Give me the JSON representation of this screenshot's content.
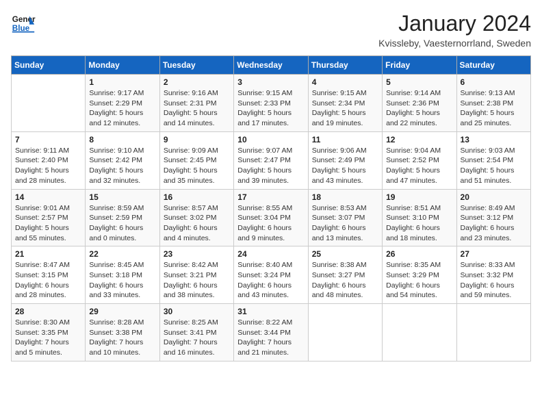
{
  "header": {
    "logo_general": "General",
    "logo_blue": "Blue",
    "title": "January 2024",
    "subtitle": "Kvissleby, Vaesternorrland, Sweden"
  },
  "calendar": {
    "days_of_week": [
      "Sunday",
      "Monday",
      "Tuesday",
      "Wednesday",
      "Thursday",
      "Friday",
      "Saturday"
    ],
    "weeks": [
      [
        {
          "day": "",
          "info": ""
        },
        {
          "day": "1",
          "info": "Sunrise: 9:17 AM\nSunset: 2:29 PM\nDaylight: 5 hours\nand 12 minutes."
        },
        {
          "day": "2",
          "info": "Sunrise: 9:16 AM\nSunset: 2:31 PM\nDaylight: 5 hours\nand 14 minutes."
        },
        {
          "day": "3",
          "info": "Sunrise: 9:15 AM\nSunset: 2:33 PM\nDaylight: 5 hours\nand 17 minutes."
        },
        {
          "day": "4",
          "info": "Sunrise: 9:15 AM\nSunset: 2:34 PM\nDaylight: 5 hours\nand 19 minutes."
        },
        {
          "day": "5",
          "info": "Sunrise: 9:14 AM\nSunset: 2:36 PM\nDaylight: 5 hours\nand 22 minutes."
        },
        {
          "day": "6",
          "info": "Sunrise: 9:13 AM\nSunset: 2:38 PM\nDaylight: 5 hours\nand 25 minutes."
        }
      ],
      [
        {
          "day": "7",
          "info": "Sunrise: 9:11 AM\nSunset: 2:40 PM\nDaylight: 5 hours\nand 28 minutes."
        },
        {
          "day": "8",
          "info": "Sunrise: 9:10 AM\nSunset: 2:42 PM\nDaylight: 5 hours\nand 32 minutes."
        },
        {
          "day": "9",
          "info": "Sunrise: 9:09 AM\nSunset: 2:45 PM\nDaylight: 5 hours\nand 35 minutes."
        },
        {
          "day": "10",
          "info": "Sunrise: 9:07 AM\nSunset: 2:47 PM\nDaylight: 5 hours\nand 39 minutes."
        },
        {
          "day": "11",
          "info": "Sunrise: 9:06 AM\nSunset: 2:49 PM\nDaylight: 5 hours\nand 43 minutes."
        },
        {
          "day": "12",
          "info": "Sunrise: 9:04 AM\nSunset: 2:52 PM\nDaylight: 5 hours\nand 47 minutes."
        },
        {
          "day": "13",
          "info": "Sunrise: 9:03 AM\nSunset: 2:54 PM\nDaylight: 5 hours\nand 51 minutes."
        }
      ],
      [
        {
          "day": "14",
          "info": "Sunrise: 9:01 AM\nSunset: 2:57 PM\nDaylight: 5 hours\nand 55 minutes."
        },
        {
          "day": "15",
          "info": "Sunrise: 8:59 AM\nSunset: 2:59 PM\nDaylight: 6 hours\nand 0 minutes."
        },
        {
          "day": "16",
          "info": "Sunrise: 8:57 AM\nSunset: 3:02 PM\nDaylight: 6 hours\nand 4 minutes."
        },
        {
          "day": "17",
          "info": "Sunrise: 8:55 AM\nSunset: 3:04 PM\nDaylight: 6 hours\nand 9 minutes."
        },
        {
          "day": "18",
          "info": "Sunrise: 8:53 AM\nSunset: 3:07 PM\nDaylight: 6 hours\nand 13 minutes."
        },
        {
          "day": "19",
          "info": "Sunrise: 8:51 AM\nSunset: 3:10 PM\nDaylight: 6 hours\nand 18 minutes."
        },
        {
          "day": "20",
          "info": "Sunrise: 8:49 AM\nSunset: 3:12 PM\nDaylight: 6 hours\nand 23 minutes."
        }
      ],
      [
        {
          "day": "21",
          "info": "Sunrise: 8:47 AM\nSunset: 3:15 PM\nDaylight: 6 hours\nand 28 minutes."
        },
        {
          "day": "22",
          "info": "Sunrise: 8:45 AM\nSunset: 3:18 PM\nDaylight: 6 hours\nand 33 minutes."
        },
        {
          "day": "23",
          "info": "Sunrise: 8:42 AM\nSunset: 3:21 PM\nDaylight: 6 hours\nand 38 minutes."
        },
        {
          "day": "24",
          "info": "Sunrise: 8:40 AM\nSunset: 3:24 PM\nDaylight: 6 hours\nand 43 minutes."
        },
        {
          "day": "25",
          "info": "Sunrise: 8:38 AM\nSunset: 3:27 PM\nDaylight: 6 hours\nand 48 minutes."
        },
        {
          "day": "26",
          "info": "Sunrise: 8:35 AM\nSunset: 3:29 PM\nDaylight: 6 hours\nand 54 minutes."
        },
        {
          "day": "27",
          "info": "Sunrise: 8:33 AM\nSunset: 3:32 PM\nDaylight: 6 hours\nand 59 minutes."
        }
      ],
      [
        {
          "day": "28",
          "info": "Sunrise: 8:30 AM\nSunset: 3:35 PM\nDaylight: 7 hours\nand 5 minutes."
        },
        {
          "day": "29",
          "info": "Sunrise: 8:28 AM\nSunset: 3:38 PM\nDaylight: 7 hours\nand 10 minutes."
        },
        {
          "day": "30",
          "info": "Sunrise: 8:25 AM\nSunset: 3:41 PM\nDaylight: 7 hours\nand 16 minutes."
        },
        {
          "day": "31",
          "info": "Sunrise: 8:22 AM\nSunset: 3:44 PM\nDaylight: 7 hours\nand 21 minutes."
        },
        {
          "day": "",
          "info": ""
        },
        {
          "day": "",
          "info": ""
        },
        {
          "day": "",
          "info": ""
        }
      ]
    ]
  }
}
